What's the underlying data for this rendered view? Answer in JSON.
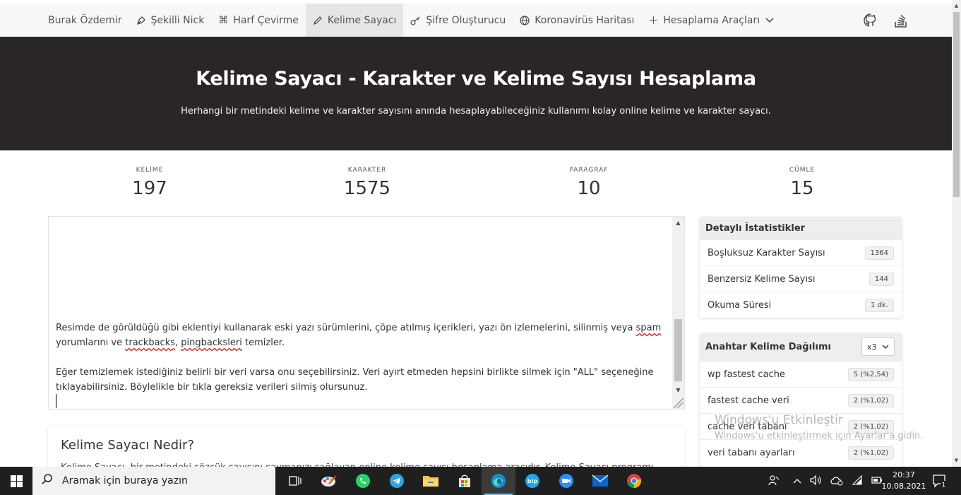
{
  "nav": {
    "items": [
      {
        "label": "Burak Özdemir",
        "icon": ""
      },
      {
        "label": "Şekilli Nick",
        "icon": "pen-nib-icon"
      },
      {
        "label": "Harf Çevirme",
        "icon": "command-icon"
      },
      {
        "label": "Kelime Sayacı",
        "icon": "pencil-icon",
        "active": true
      },
      {
        "label": "Şifre Oluşturucu",
        "icon": "key-icon"
      },
      {
        "label": "Koronavirüs Haritası",
        "icon": "globe-icon"
      },
      {
        "label": "Hesaplama Araçları",
        "icon": "plus-icon"
      }
    ],
    "right_icons": [
      "github-icon",
      "stackoverflow-icon"
    ]
  },
  "hero": {
    "title": "Kelime Sayacı - Karakter ve Kelime Sayısı Hesaplama",
    "subtitle": "Herhangi bir metindeki kelime ve karakter sayısını anında hesaplayabileceğiniz kullanımı kolay online kelime ve karakter sayacı."
  },
  "stats": [
    {
      "label": "KELİME",
      "value": "197"
    },
    {
      "label": "KARAKTER",
      "value": "1575"
    },
    {
      "label": "PARAGRAF",
      "value": "10"
    },
    {
      "label": "CÜMLE",
      "value": "15"
    }
  ],
  "editor": {
    "p1_a": "Resimde de görüldüğü gibi eklentiyi kullanarak eski yazı sürümlerini, çöpe atılmış içerikleri, yazı ön izlemelerini, silinmiş veya ",
    "p1_spam": "spam",
    "p1_b": "yorumlarını ve ",
    "p1_trackbacks": "trackbacks",
    "p1_sep": ", ",
    "p1_pingbacksleri": "pingbacksleri",
    "p1_c": " temizler.",
    "p2": "Eğer temizlemek istediğiniz belirli bir veri varsa onu seçebilirsiniz. Veri ayırt etmeden hepsini birlikte silmek için \"ALL\" seçeneğine tıklayabilirsiniz. Böylelikle bir tıkla gereksiz verileri silmiş olursunuz."
  },
  "article": {
    "title": "Kelime Sayacı Nedir?",
    "text": "Kelime Sayacı, bir metindeki sözcük sayısını saymanızı sağlayan online kelime sayısı hesaplama aracıdır. Kelime Sayacı programı"
  },
  "details": {
    "title": "Detaylı İstatistikler",
    "rows": [
      {
        "label": "Boşluksuz Karakter Sayısı",
        "value": "1364"
      },
      {
        "label": "Benzersiz Kelime Sayısı",
        "value": "144"
      },
      {
        "label": "Okuma Süresi",
        "value": "1 dk."
      }
    ]
  },
  "keywords": {
    "title": "Anahtar Kelime Dağılımı",
    "selected": "x3",
    "rows": [
      {
        "label": "wp fastest cache",
        "value": "5 (%2,54)"
      },
      {
        "label": "fastest cache veri",
        "value": "2 (%1,02)"
      },
      {
        "label": "cache veri tabanı",
        "value": "2 (%1,02)"
      },
      {
        "label": "veri tabanı ayarları",
        "value": "2 (%1,02)"
      }
    ]
  },
  "watermark": {
    "line1": "Windows'u Etkinleştir",
    "line2": "Windows'u etkinleştirmek için Ayarlar'a gidin."
  },
  "taskbar": {
    "search_placeholder": "Aramak için buraya yazın",
    "apps": [
      "task-view-icon",
      "paint-icon",
      "whatsapp-icon",
      "telegram-icon",
      "file-explorer-icon",
      "store-icon",
      "edge-icon",
      "bip-icon",
      "zoom-icon",
      "mail-icon",
      "chrome-icon"
    ],
    "active_app": "edge-icon",
    "time": "20:37",
    "date": "10.08.2021",
    "notification_count": "1"
  },
  "colors": {
    "hero_bg": "#2a2626",
    "nav_bg": "#f7f7f7",
    "taskbar_bg": "#1f1f1f",
    "spell_error": "#dd1111"
  }
}
